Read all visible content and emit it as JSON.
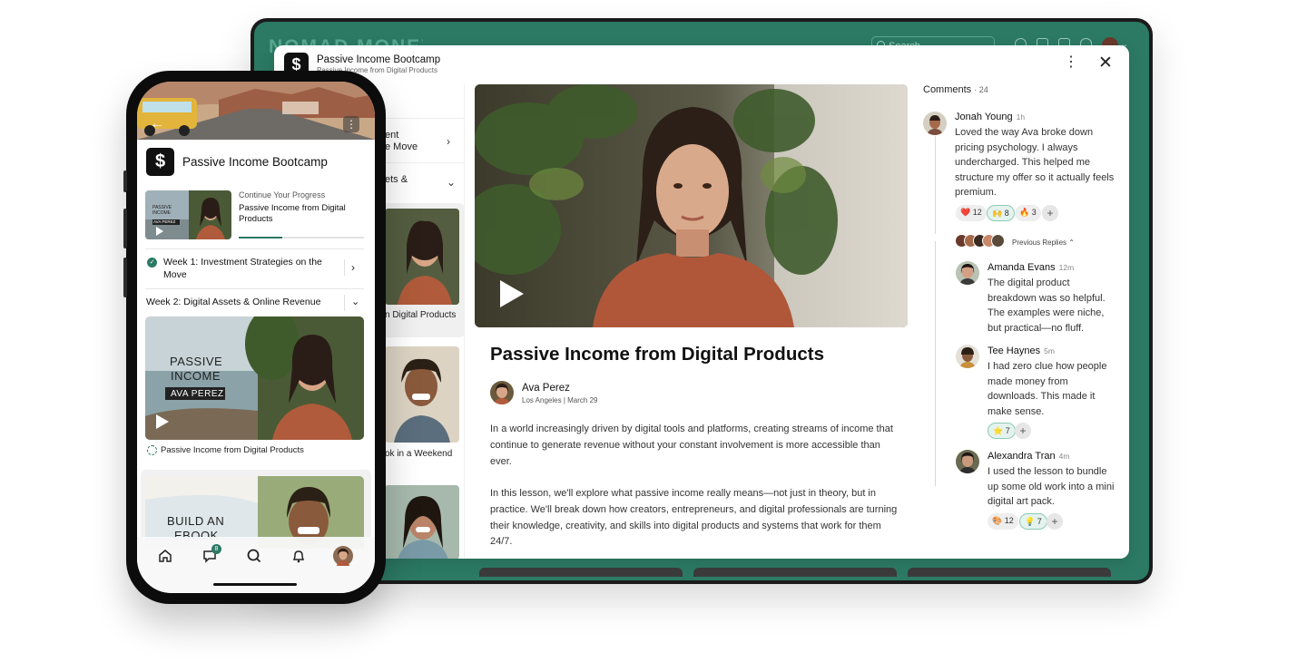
{
  "desktop": {
    "brand": "N",
    "search_placeholder": "Search",
    "modal": {
      "course_title": "Passive Income Bootcamp",
      "lesson_subtitle": "Passive Income from Digital Products",
      "sidebar": {
        "module1_partial": "ent\ne Move",
        "module2_partial": "ets &",
        "card1_caption": "n Digital Products",
        "card2_caption": "ok in a Weekend"
      },
      "lesson": {
        "title": "Passive Income from Digital Products",
        "author": "Ava Perez",
        "author_meta": "Los Angeles | March 29",
        "paragraphs": [
          "In a world increasingly driven by digital tools and platforms, creating streams of income that continue to generate revenue without your constant involvement is more accessible than ever.",
          "In this lesson, we'll explore what passive income really means—not just in theory, but in practice. We'll break down how creators, entrepreneurs, and digital professionals are turning their knowledge, creativity, and skills into digital products and systems that work for them 24/7."
        ]
      },
      "comments": {
        "label": "Comments",
        "count": "24",
        "previous_replies": "Previous Replies",
        "items": [
          {
            "name": "Jonah Young",
            "time": "1h",
            "text": "Loved the way Ava broke down pricing psychology. I always undercharged. This helped me structure my offer so it actually feels premium.",
            "reactions": [
              {
                "emoji": "❤️",
                "count": "12"
              },
              {
                "emoji": "🙌",
                "count": "8"
              },
              {
                "emoji": "🔥",
                "count": "3"
              }
            ]
          },
          {
            "name": "Amanda Evans",
            "time": "12m",
            "text": "The digital product breakdown was so helpful. The examples were niche, but practical—no fluff.",
            "reactions": []
          },
          {
            "name": "Tee Haynes",
            "time": "5m",
            "text": "I had zero clue how people made money from downloads. This made it make sense.",
            "reactions": [
              {
                "emoji": "⭐",
                "count": "7"
              }
            ]
          },
          {
            "name": "Alexandra Tran",
            "time": "4m",
            "text": "I used the lesson to bundle up some old work into a mini digital art pack.",
            "reactions": [
              {
                "emoji": "🎨",
                "count": "12"
              },
              {
                "emoji": "💡",
                "count": "7"
              }
            ]
          }
        ],
        "add_reaction": "+"
      }
    }
  },
  "phone": {
    "course_title": "Passive Income Bootcamp",
    "continue": {
      "label": "Continue Your Progress",
      "lesson": "Passive Income from Digital Products",
      "thumb_text": "PASSIVE\nINCOME",
      "thumb_name": "AVA PEREZ",
      "progress": 0.35
    },
    "week1": "Week 1: Investment Strategies on the Move",
    "week2": "Week 2: Digital Assets & Online Revenue",
    "card1": {
      "title_line1": "PASSIVE",
      "title_line2": "INCOME",
      "name_tag": "AVA PEREZ",
      "caption": "Passive Income from Digital Products"
    },
    "card2": {
      "title_line1": "BUILD AN",
      "title_line2": "EBOOK"
    },
    "tabbar": {
      "messages_badge": "8"
    }
  }
}
